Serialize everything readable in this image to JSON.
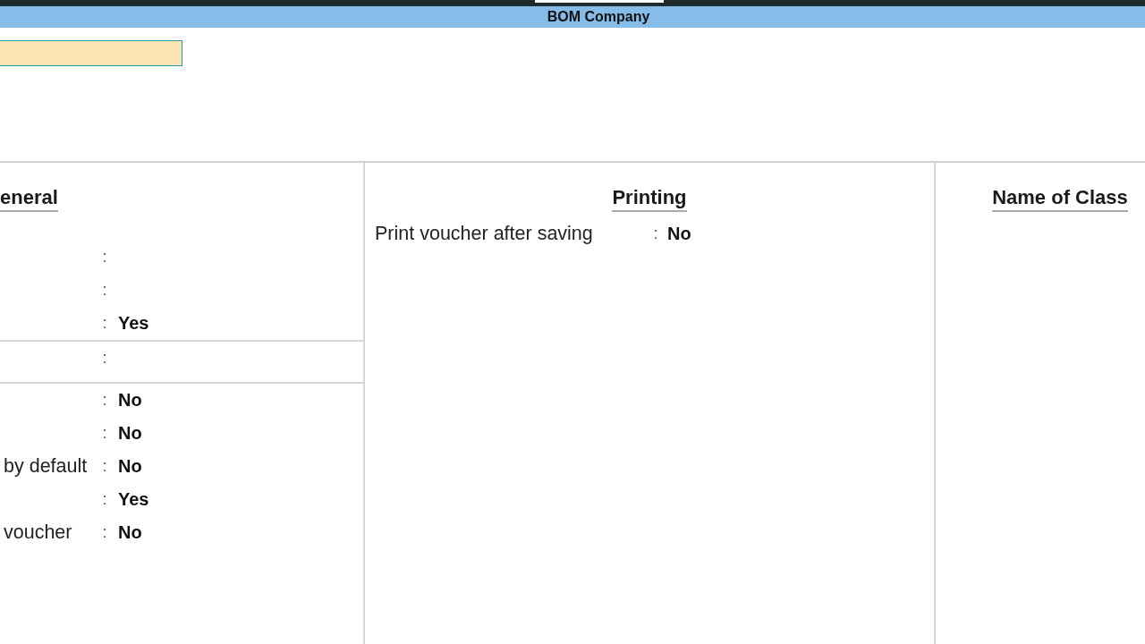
{
  "window": {
    "title": "BOM Company"
  },
  "name_field": {
    "focused": true
  },
  "sections": [
    {
      "title": "eneral",
      "groups": [
        [
          {
            "separator": ":"
          },
          {
            "separator": ":"
          },
          {
            "separator": ":",
            "value": "Yes"
          }
        ],
        [
          {
            "separator": ":"
          }
        ],
        [
          {
            "separator": ":",
            "value": "No"
          },
          {
            "separator": ":",
            "value": "No"
          },
          {
            "label": "by default",
            "separator": ":",
            "value": "No"
          },
          {
            "separator": ":",
            "value": "Yes"
          },
          {
            "label": "voucher",
            "separator": ":",
            "value": "No"
          }
        ]
      ]
    },
    {
      "title": "Printing",
      "groups": [
        [
          {
            "label": "Print voucher after saving",
            "separator": ":",
            "value": "No"
          }
        ]
      ]
    },
    {
      "title": "Name of Class"
    }
  ]
}
